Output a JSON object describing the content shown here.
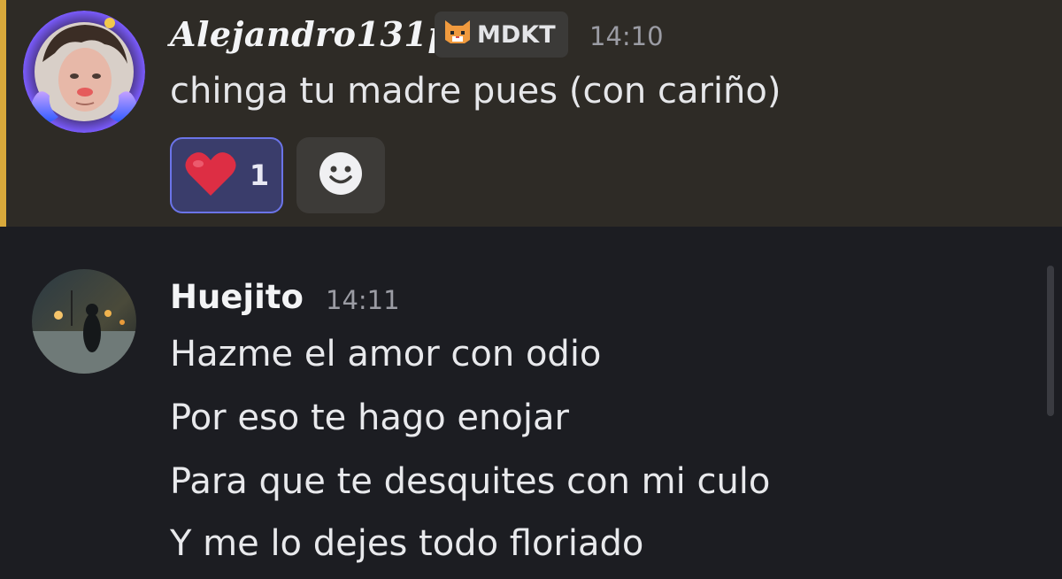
{
  "messages": [
    {
      "username": "Alejandro131p",
      "clan_tag": "MDKT",
      "clan_icon": "cat-icon",
      "timestamp": "14:10",
      "content": "chinga tu madre pues (con cariño)",
      "highlighted": true,
      "highlight_color": "#d9a93b",
      "reactions": [
        {
          "emoji": "heart-emoji",
          "count": "1",
          "selected": true
        }
      ],
      "add_reaction_icon": "smiley-icon"
    },
    {
      "username": "Huejito",
      "timestamp": "14:11",
      "lines": [
        "Hazme el amor con odio",
        "Por eso te hago enojar",
        "Para que te desquites con mi culo",
        "Y me lo dejes todo floriado"
      ]
    }
  ],
  "colors": {
    "background": "#1c1d22",
    "highlight_background": "#2e2b26",
    "reaction_selected_bg": "#3a3d6b",
    "reaction_selected_border": "#6b74e8"
  }
}
